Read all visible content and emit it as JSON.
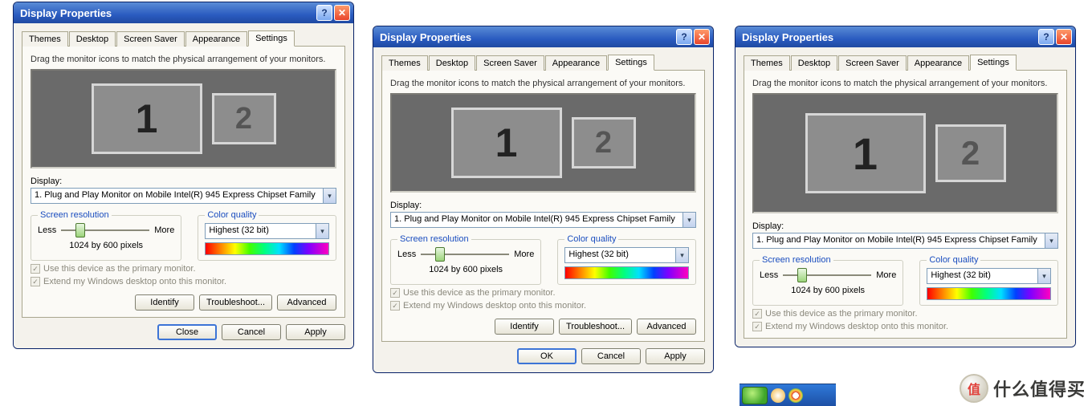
{
  "window_title": "Display Properties",
  "tabs": [
    "Themes",
    "Desktop",
    "Screen Saver",
    "Appearance",
    "Settings"
  ],
  "active_tab": "Settings",
  "instruction": "Drag the monitor icons to match the physical arrangement of your monitors.",
  "monitors": {
    "primary": "1",
    "secondary": "2"
  },
  "display_label": "Display:",
  "display_value": "1. Plug and Play Monitor on Mobile Intel(R) 945 Express Chipset Family",
  "resolution": {
    "legend": "Screen resolution",
    "less": "Less",
    "more": "More",
    "value": "1024 by 600 pixels"
  },
  "color": {
    "legend": "Color quality",
    "value": "Highest (32 bit)"
  },
  "checkbox_primary": "Use this device as the primary monitor.",
  "checkbox_extend": "Extend my Windows desktop onto this monitor.",
  "buttons": {
    "identify": "Identify",
    "troubleshoot": "Troubleshoot...",
    "advanced": "Advanced"
  },
  "bottom_buttons_variant_a": {
    "close": "Close",
    "cancel": "Cancel",
    "apply": "Apply"
  },
  "bottom_buttons_variant_b": {
    "ok": "OK",
    "cancel": "Cancel",
    "apply": "Apply"
  },
  "watermark": {
    "symbol": "值",
    "text": "什么值得买"
  }
}
